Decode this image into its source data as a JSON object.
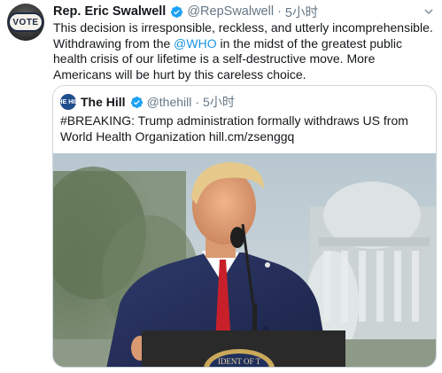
{
  "tweet": {
    "avatar_text": "VOTE",
    "author_name": "Rep. Eric Swalwell",
    "handle": "@RepSwalwell",
    "separator": "·",
    "time": "5小时",
    "text_before_mention": "This decision is irresponsible, reckless, and utterly incomprehensible. Withdrawing from the ",
    "mention": "@WHO",
    "text_after_mention": " in the midst of the greatest public health crisis of our lifetime is a self-destructive move. More Americans will be hurt by this careless choice."
  },
  "quote": {
    "avatar_text": "THE HILL",
    "author_name": "The Hill",
    "handle": "@thehill",
    "separator": "·",
    "time": "5小时",
    "text": "#BREAKING: Trump administration formally withdraws US from World Health Organization hill.cm/zsenggq",
    "seal_text": "IDENT OF T"
  },
  "colors": {
    "link": "#1b95e0",
    "secondary": "#657786",
    "verified": "#1da1f2",
    "border": "#ccd6dd"
  }
}
